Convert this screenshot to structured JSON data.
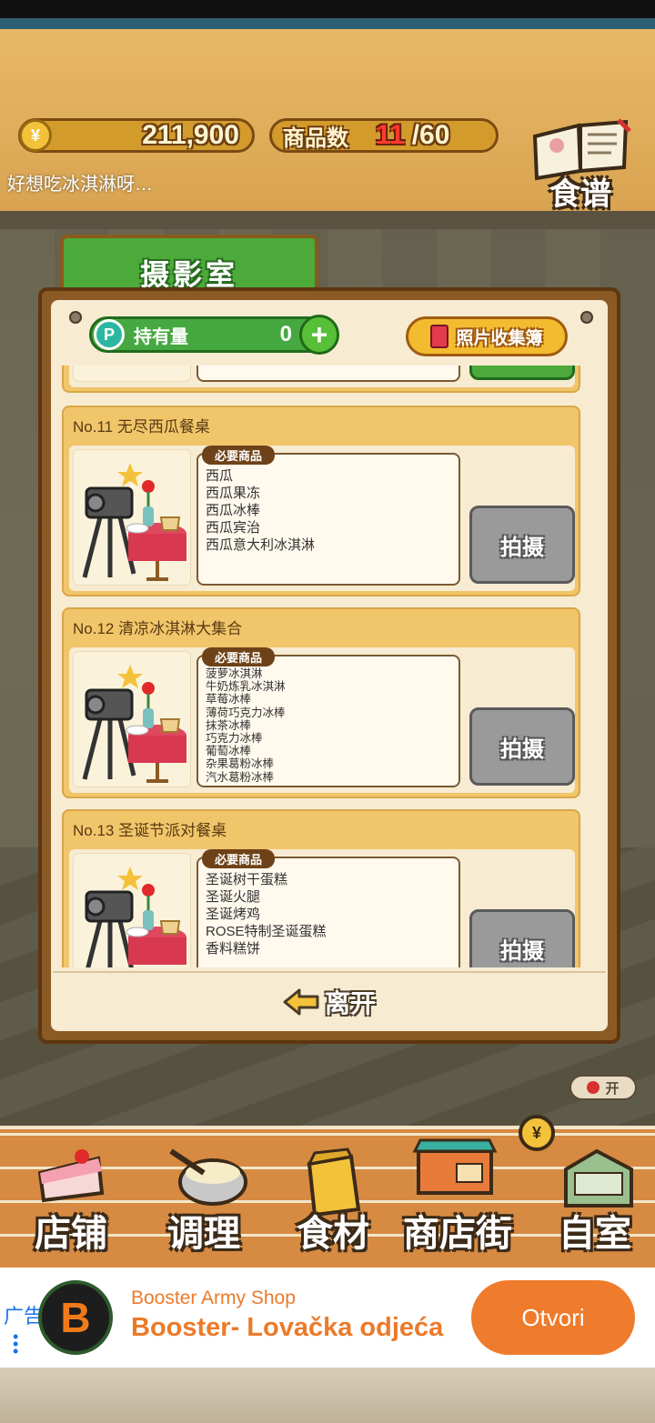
{
  "hud": {
    "money": "211,900",
    "money_icon": "yen-coin-icon",
    "product_count_label": "商品数",
    "product_count_current": "11",
    "product_count_max": "/60",
    "recipe_label": "食谱"
  },
  "dialog": "好想吃冰淇淋呀…",
  "studio": {
    "tab_title": "摄影室",
    "holdings_label": "持有量",
    "holdings_value": "0",
    "album_label": "照片收集簿",
    "needs_tag": "必要商品",
    "shoot_label": "拍摄",
    "entries": [
      {
        "title": "No.11 无尽西瓜餐桌",
        "items": [
          "西瓜",
          "西瓜果冻",
          "西瓜冰棒",
          "西瓜宾治",
          "西瓜意大利冰淇淋"
        ]
      },
      {
        "title": "No.12 清凉冰淇淋大集合",
        "items": [
          "菠萝冰淇淋",
          "牛奶炼乳冰淇淋",
          "草莓冰棒",
          "薄荷巧克力冰棒",
          "抹茶冰棒",
          "巧克力冰棒",
          "葡萄冰棒",
          "杂果葛粉冰棒",
          "汽水葛粉冰棒"
        ]
      },
      {
        "title": "No.13 圣诞节派对餐桌",
        "items": [
          "圣诞树干蛋糕",
          "圣诞火腿",
          "圣诞烤鸡",
          "ROSE特制圣诞蛋糕",
          "香料糕饼"
        ]
      }
    ],
    "leave_label": "离开"
  },
  "toggle_label": "开",
  "nav": {
    "shop": "店铺",
    "cook": "调理",
    "ingredients": "食材",
    "street": "商店街",
    "room": "自室"
  },
  "ad": {
    "tag": "广告",
    "advertiser": "Booster Army Shop",
    "title": "Booster- Lovačka odjeća",
    "cta": "Otvori",
    "logo_letter": "B"
  },
  "colors": {
    "accent_green": "#4caa3b",
    "shoot_disabled": "#9a9a9a",
    "ad_orange": "#ef7b2c",
    "count_red": "#ff3a2a"
  }
}
